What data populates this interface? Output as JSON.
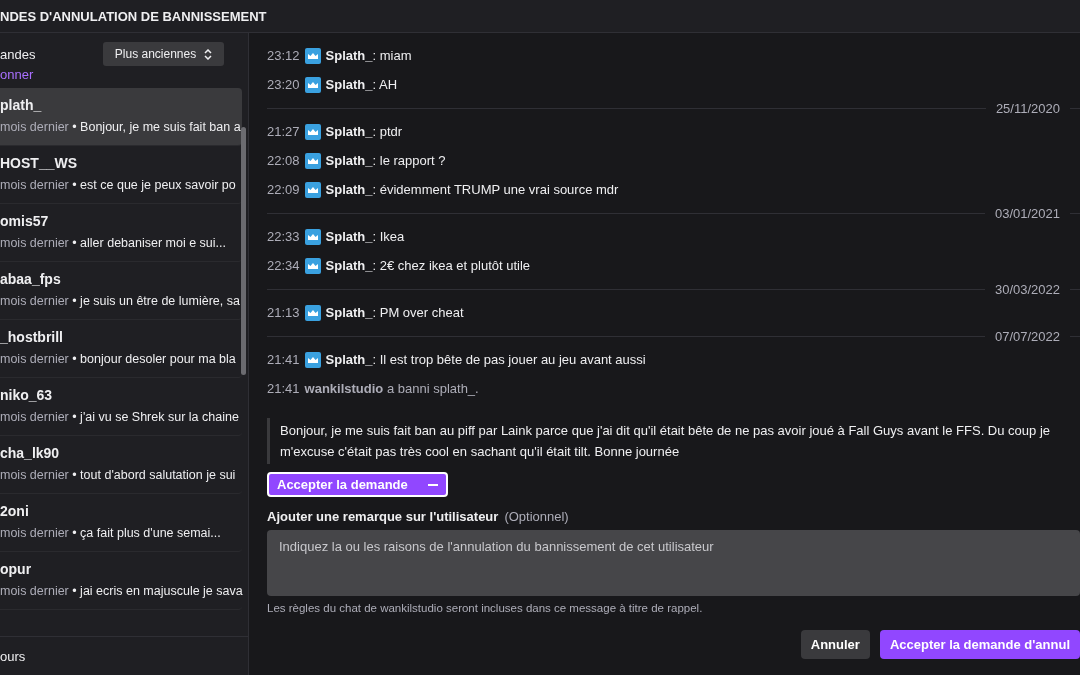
{
  "header": {
    "title": "NDES D'ANNULATION DE BANNISSEMENT"
  },
  "sidebar": {
    "filter_label": "andes",
    "sort": {
      "label": "Plus anciennes"
    },
    "select_link": "onner",
    "requests": [
      {
        "user": "plath_",
        "age": "mois dernier",
        "preview": "• Bonjour, je me suis fait ban a",
        "selected": true
      },
      {
        "user": "HOST__WS",
        "age": "mois dernier",
        "preview": "• est ce que je peux savoir po",
        "selected": false
      },
      {
        "user": "omis57",
        "age": "mois dernier",
        "preview": "• aller debaniser moi e sui...",
        "selected": false
      },
      {
        "user": "abaa_fps",
        "age": "mois dernier",
        "preview": "• je suis un être de lumière, sa",
        "selected": false
      },
      {
        "user": "_hostbrill",
        "age": "mois dernier",
        "preview": "• bonjour desoler pour ma bla",
        "selected": false
      },
      {
        "user": "niko_63",
        "age": "mois dernier",
        "preview": "• j'ai vu se Shrek sur la chaine",
        "selected": false
      },
      {
        "user": "cha_lk90",
        "age": "mois dernier",
        "preview": "• tout d'abord salutation je sui",
        "selected": false
      },
      {
        "user": "2oni",
        "age": "mois dernier",
        "preview": "• ça fait plus d'une semai...",
        "selected": false
      },
      {
        "user": "opur",
        "age": "mois dernier",
        "preview": "• jai ecris en majuscule je sava",
        "selected": false
      }
    ],
    "footer": "ours"
  },
  "chat": [
    {
      "kind": "message",
      "time": "23:12",
      "text": "**Splath_**: miam"
    },
    {
      "kind": "message",
      "time": "23:20",
      "text": "**Splath_**: AH"
    },
    {
      "kind": "date",
      "text": "25/11/2020"
    },
    {
      "kind": "message",
      "time": "21:27",
      "text": "**Splath_**: ptdr"
    },
    {
      "kind": "message",
      "time": "22:08",
      "text": "**Splath_**: le rapport ?"
    },
    {
      "kind": "message",
      "time": "22:09",
      "text": "**Splath_**: évidemment TRUMP une vrai source mdr"
    },
    {
      "kind": "date",
      "text": "03/01/2021"
    },
    {
      "kind": "message",
      "time": "22:33",
      "text": "**Splath_**: Ikea"
    },
    {
      "kind": "message",
      "time": "22:34",
      "text": "**Splath_**: 2€ chez ikea et plutôt utile"
    },
    {
      "kind": "date",
      "text": "30/03/2022"
    },
    {
      "kind": "message",
      "time": "21:13",
      "text": "**Splath_**: PM over cheat"
    },
    {
      "kind": "date",
      "text": "07/07/2022"
    },
    {
      "kind": "message",
      "time": "21:41",
      "text": "**Splath_**: Il est trop bête de pas jouer au jeu avant aussi"
    },
    {
      "kind": "event",
      "time": "21:41",
      "user": "wankilstudio",
      "text": "a banni splath_."
    }
  ],
  "request": {
    "quote": "Bonjour, je me suis fait ban au piff par Laink parce que j'ai dit qu'il était bête de ne pas avoir joué à Fall Guys avant le FFS. Du coup je m'excuse c'était pas très cool en sachant qu'il était tilt. Bonne journée",
    "decision": {
      "label": "Accepter la demande"
    },
    "note_label": "Ajouter une remarque sur l'utilisateur",
    "note_optional": "(Optionnel)",
    "note_placeholder": "Indiquez la ou les raisons de l'annulation du bannissement de cet utilisateur",
    "rules_hint": "Les règles du chat de wankilstudio seront incluses dans ce message à titre de rappel.",
    "buttons": [
      {
        "kind": "secondary",
        "label": "Annuler"
      },
      {
        "kind": "primary",
        "label": "Accepter la demande d'annul"
      }
    ]
  }
}
